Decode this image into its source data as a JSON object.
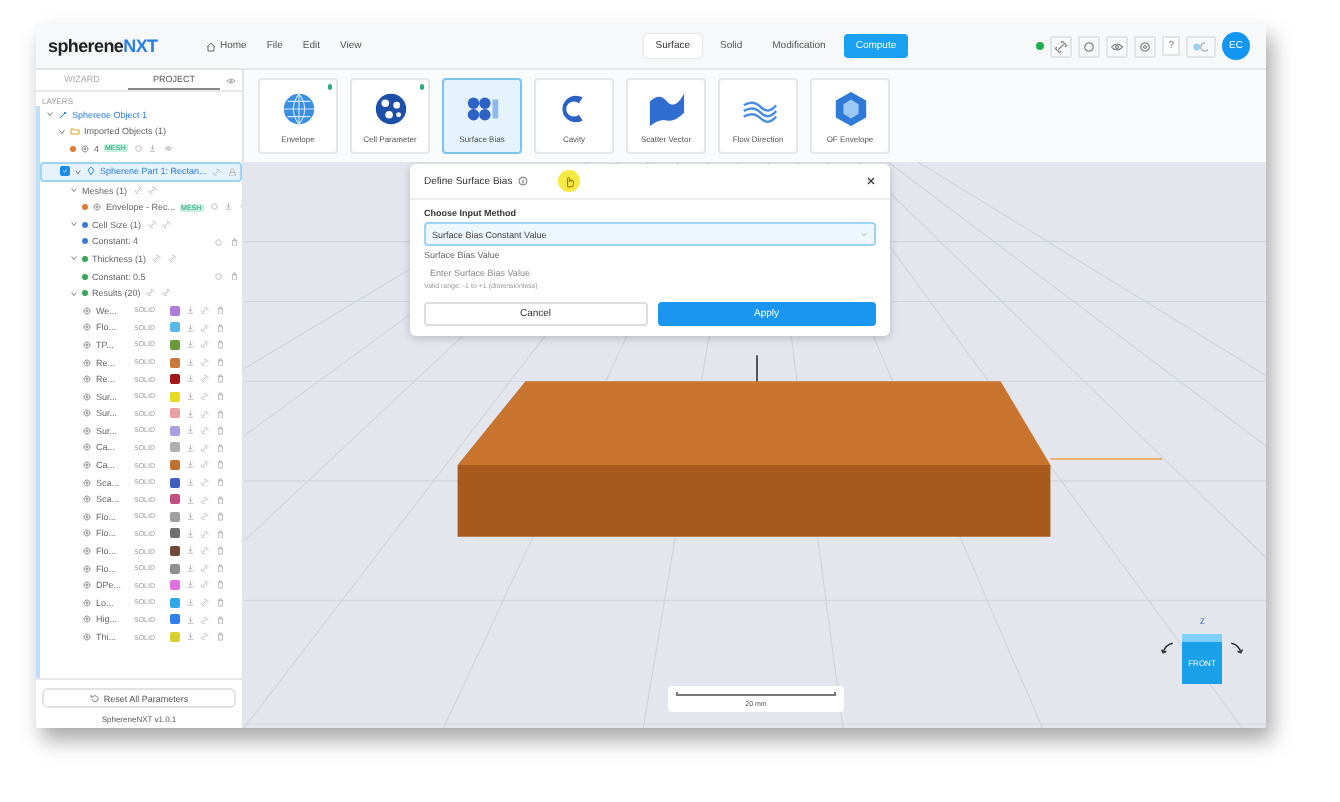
{
  "app": {
    "logo_main": "spherene",
    "logo_accent": "NXT"
  },
  "nav": [
    {
      "label": "Home",
      "kind": "home"
    },
    {
      "label": "File",
      "kind": "menu"
    },
    {
      "label": "Edit",
      "kind": "menu"
    },
    {
      "label": "View",
      "kind": "menu"
    }
  ],
  "mode_tabs": [
    {
      "label": "Surface",
      "selected": true,
      "kind": "tab"
    },
    {
      "label": "Solid",
      "selected": false,
      "kind": "tab"
    },
    {
      "label": "Modification",
      "selected": false,
      "kind": "tab"
    },
    {
      "label": "Compute",
      "selected": false,
      "kind": "action"
    }
  ],
  "toolbar": {
    "help_label": "?",
    "user_initials": "EC"
  },
  "sidebar": {
    "tabs": [
      {
        "label": "WIZARD",
        "selected": false
      },
      {
        "label": "PROJECT",
        "selected": true
      }
    ],
    "section": "LAYERS",
    "tree": [
      {
        "kind": "object",
        "label": "Spherene Object 1",
        "expanded": true,
        "children": [
          {
            "kind": "folder",
            "label": "Imported Objects (1)",
            "expanded": true,
            "children": [
              {
                "kind": "mesh",
                "label": "4",
                "badge": "MESH",
                "color": "#e07b39"
              }
            ]
          },
          {
            "kind": "part",
            "label": "Spherene Part 1: Rectan...",
            "expanded": true,
            "checked": true,
            "children": [
              {
                "kind": "group",
                "label": "Meshes (1)",
                "expanded": true,
                "children": [
                  {
                    "kind": "mesh",
                    "label": "Envelope - Rec...",
                    "badge": "MESH",
                    "color": "#e07b39"
                  }
                ]
              },
              {
                "kind": "group",
                "label": "Cell Size (1)",
                "color": "#3a7bd5",
                "expanded": true,
                "children": [
                  {
                    "kind": "value",
                    "label": "Constant: 4",
                    "color": "#3a7bd5"
                  }
                ]
              },
              {
                "kind": "group",
                "label": "Thickness (1)",
                "color": "#3aa35a",
                "expanded": true,
                "children": [
                  {
                    "kind": "value",
                    "label": "Constant: 0.5",
                    "color": "#3aa35a"
                  }
                ]
              },
              {
                "kind": "group",
                "label": "Results (20)",
                "color": "#3aa35a",
                "expanded": true,
                "children": [
                  {
                    "kind": "result",
                    "label": "We...",
                    "badge": "SOLID",
                    "color": "#b07ad8"
                  },
                  {
                    "kind": "result",
                    "label": "Flo...",
                    "badge": "SOLID",
                    "color": "#5ab8e8"
                  },
                  {
                    "kind": "result",
                    "label": "TP...",
                    "badge": "SOLID",
                    "color": "#6a9a3a"
                  },
                  {
                    "kind": "result",
                    "label": "Re...",
                    "badge": "SOLID",
                    "color": "#c8783a"
                  },
                  {
                    "kind": "result",
                    "label": "Re...",
                    "badge": "SOLID",
                    "color": "#a01818"
                  },
                  {
                    "kind": "result",
                    "label": "Sur...",
                    "badge": "SOLID",
                    "color": "#e8d820"
                  },
                  {
                    "kind": "result",
                    "label": "Sur...",
                    "badge": "SOLID",
                    "color": "#e8a0a0"
                  },
                  {
                    "kind": "result",
                    "label": "Sur...",
                    "badge": "SOLID",
                    "color": "#a8a0e0"
                  },
                  {
                    "kind": "result",
                    "label": "Ca...",
                    "badge": "SOLID",
                    "color": "#b0b0b0"
                  },
                  {
                    "kind": "result",
                    "label": "Ca...",
                    "badge": "SOLID",
                    "color": "#c07030"
                  },
                  {
                    "kind": "result",
                    "label": "Sca...",
                    "badge": "SOLID",
                    "color": "#4060c0"
                  },
                  {
                    "kind": "result",
                    "label": "Sca...",
                    "badge": "SOLID",
                    "color": "#c05080"
                  },
                  {
                    "kind": "result",
                    "label": "Flo...",
                    "badge": "SOLID",
                    "color": "#a0a0a0"
                  },
                  {
                    "kind": "result",
                    "label": "Flo...",
                    "badge": "SOLID",
                    "color": "#707070"
                  },
                  {
                    "kind": "result",
                    "label": "Flo...",
                    "badge": "SOLID",
                    "color": "#704838"
                  },
                  {
                    "kind": "result",
                    "label": "Flo...",
                    "badge": "SOLID",
                    "color": "#909090"
                  },
                  {
                    "kind": "result",
                    "label": "DPe...",
                    "badge": "SOLID",
                    "color": "#e070e0"
                  },
                  {
                    "kind": "result",
                    "label": "Lo...",
                    "badge": "SOLID",
                    "color": "#30a8e8"
                  },
                  {
                    "kind": "result",
                    "label": "Hig...",
                    "badge": "SOLID",
                    "color": "#3080e8"
                  },
                  {
                    "kind": "result",
                    "label": "Thi...",
                    "badge": "SOLID",
                    "color": "#d8d030"
                  }
                ]
              }
            ]
          }
        ]
      }
    ],
    "reset_button": "Reset All Parameters",
    "version": "SphereneNXT v1.0.1"
  },
  "tools": [
    {
      "label": "Envelope",
      "kind": "globe",
      "done": true,
      "selected": false
    },
    {
      "label": "Cell Parameter",
      "kind": "cells",
      "done": true,
      "selected": false
    },
    {
      "label": "Surface Bias",
      "kind": "bias",
      "done": false,
      "selected": true
    },
    {
      "label": "Cavity",
      "kind": "cavity",
      "done": false,
      "selected": false
    },
    {
      "label": "Scatter Vector",
      "kind": "scatter",
      "done": false,
      "selected": false
    },
    {
      "label": "Flow Direction",
      "kind": "flow",
      "done": false,
      "selected": false
    },
    {
      "label": "OF Envelope",
      "kind": "hex",
      "done": false,
      "selected": false
    }
  ],
  "dialog": {
    "title": "Define Surface Bias",
    "method_label": "Choose Input Method",
    "method_value": "Surface Bias Constant Value",
    "value_label": "Surface Bias Value",
    "value_placeholder": "Enter Surface Bias Value",
    "hint": "Valid range: -1 to +1 (dimensionless)",
    "buttons": [
      {
        "label": "Cancel",
        "kind": "secondary"
      },
      {
        "label": "Apply",
        "kind": "primary"
      }
    ]
  },
  "viewport": {
    "scale_label": "20 mm",
    "cube_face": "FRONT",
    "axis_label": "Z"
  }
}
